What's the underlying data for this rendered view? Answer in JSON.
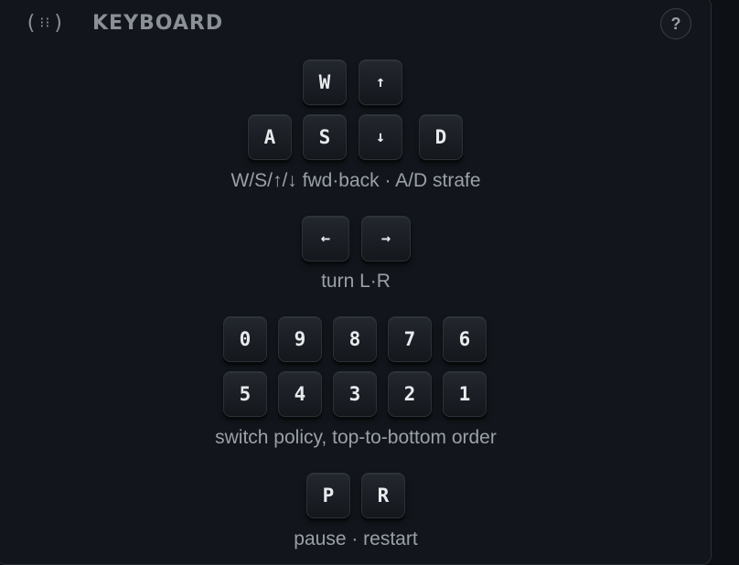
{
  "header": {
    "icon_glyph": "(:::)",
    "title": "KEYBOARD",
    "help_label": "?"
  },
  "movement": {
    "keys": {
      "w": "W",
      "up": "↑",
      "a": "A",
      "s": "S",
      "down": "↓",
      "d": "D"
    },
    "caption": "W/S/↑/↓ fwd·back · A/D strafe"
  },
  "turn": {
    "keys": {
      "left": "←",
      "right": "→"
    },
    "caption": "turn L·R"
  },
  "policy": {
    "row1": [
      "0",
      "9",
      "8",
      "7",
      "6"
    ],
    "row2": [
      "5",
      "4",
      "3",
      "2",
      "1"
    ],
    "caption": "switch policy, top-to-bottom order"
  },
  "control": {
    "keys": {
      "pause": "P",
      "restart": "R"
    },
    "caption": "pause · restart"
  }
}
